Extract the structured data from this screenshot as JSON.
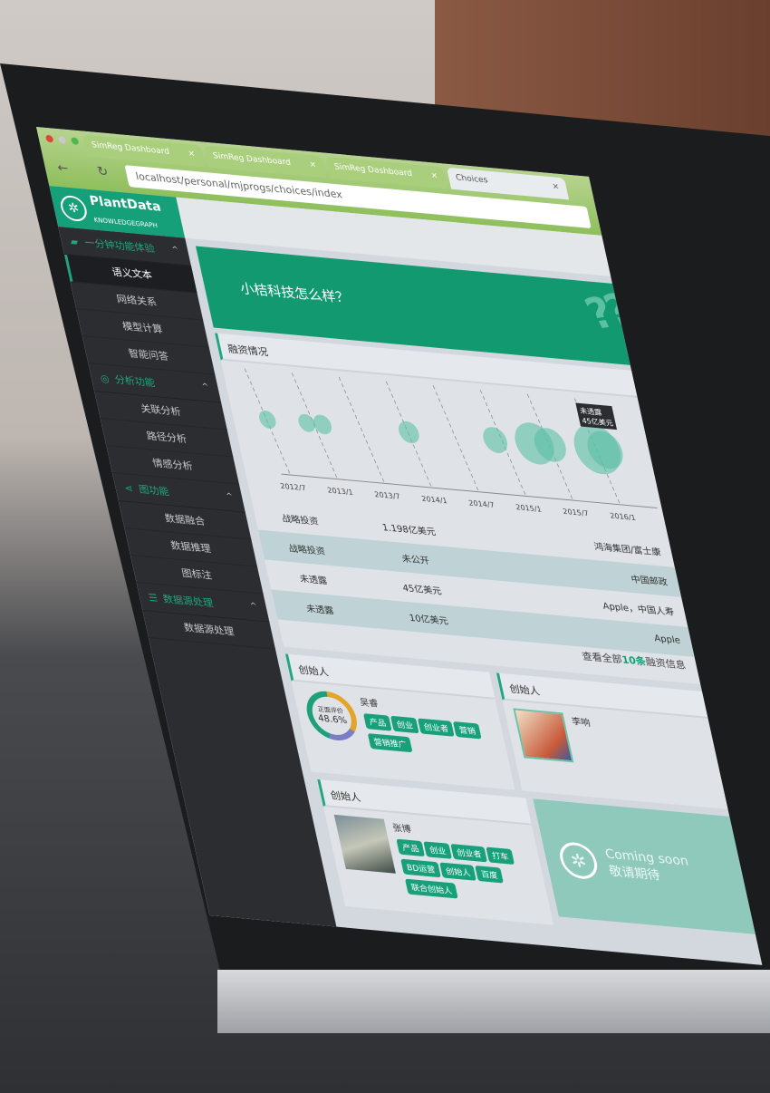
{
  "browser": {
    "tabs": [
      "SimReg Dashboard",
      "SimReg Dashboard",
      "SimReg Dashboard",
      "Choices"
    ],
    "url": "localhost/personal/mjprogs/choices/index"
  },
  "logo": {
    "name": "PlantData",
    "sub": "KNOWLEDGEGRAPH"
  },
  "sidebar": {
    "groups": [
      {
        "label": "一分钟功能体验",
        "items": [
          "语义文本",
          "网络关系",
          "模型计算",
          "智能问答"
        ]
      },
      {
        "label": "分析功能",
        "items": [
          "关联分析",
          "路径分析",
          "情感分析"
        ]
      },
      {
        "label": "图功能",
        "items": [
          "数据融合",
          "数据推理",
          "图标注"
        ]
      },
      {
        "label": "数据源处理",
        "items": [
          "数据源处理"
        ]
      }
    ]
  },
  "banner": {
    "question": "小桔科技怎么样？"
  },
  "funding": {
    "title": "融资情况",
    "tooltip": {
      "line1": "未透露",
      "line2": "45亿美元"
    },
    "rows": [
      {
        "type": "战略投资",
        "amount": "1.198亿美元",
        "investor": "鸿海集团/富士康"
      },
      {
        "type": "战略投资",
        "amount": "未公开",
        "investor": "中国邮政"
      },
      {
        "type": "未透露",
        "amount": "45亿美元",
        "investor": "Apple，中国人寿"
      },
      {
        "type": "未透露",
        "amount": "10亿美元",
        "investor": "Apple"
      }
    ],
    "more_prefix": "查看全部",
    "more_count": "10条",
    "more_suffix": "融资信息"
  },
  "chart_data": {
    "type": "scatter",
    "title": "融资情况",
    "x_ticks": [
      "2012/7",
      "2013/1",
      "2013/7",
      "2014/1",
      "2014/7",
      "2015/1",
      "2015/7",
      "2016/1"
    ],
    "points": [
      {
        "x": "2012/7",
        "size": 1
      },
      {
        "x": "2012/12",
        "size": 1
      },
      {
        "x": "2013/2",
        "size": 1.2
      },
      {
        "x": "2014/1",
        "size": 1.5
      },
      {
        "x": "2014/12",
        "size": 2
      },
      {
        "x": "2015/5",
        "size": 4
      },
      {
        "x": "2015/7",
        "size": 3
      },
      {
        "x": "2016/1",
        "size": 5
      },
      {
        "x": "2016/2",
        "size": 3.5
      }
    ],
    "color": "#5cbfa5"
  },
  "founders": [
    {
      "title": "创始人",
      "name": "吴睿",
      "rating_label": "正面评价",
      "rating": "48.6%",
      "tags": [
        "产品",
        "创业",
        "创业者",
        "营销",
        "营销推广"
      ]
    },
    {
      "title": "创始人",
      "name": "李响",
      "tags": []
    },
    {
      "title": "创始人",
      "name": "张博",
      "tags": [
        "产品",
        "创业",
        "创业者",
        "打车",
        "BD运营",
        "创始人",
        "百度",
        "联合创始人"
      ]
    }
  ],
  "coming": {
    "line1": "Coming soon",
    "line2": "敬请期待"
  }
}
